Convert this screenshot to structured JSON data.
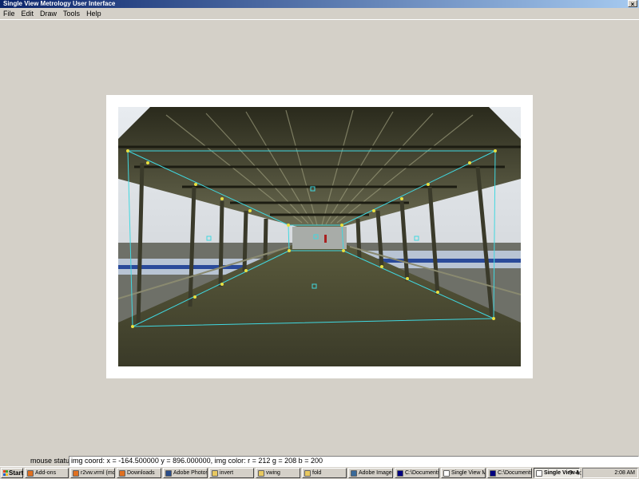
{
  "window": {
    "title": "Single View Metrology User Interface",
    "close_glyph": "×"
  },
  "menu": [
    {
      "label": "File",
      "mnemonic": "F"
    },
    {
      "label": "Edit",
      "mnemonic": "E"
    },
    {
      "label": "Draw",
      "mnemonic": "D"
    },
    {
      "label": "Tools",
      "mnemonic": "T"
    },
    {
      "label": "Help",
      "mnemonic": "H"
    }
  ],
  "status": {
    "label": "mouse status:",
    "text": "img coord: x = -164.500000 y = 896.000000, img color: r = 212 g = 208 b = 200"
  },
  "taskbar": {
    "start_label": "Start",
    "buttons": [
      {
        "label": "Add-ons",
        "icon": "firefox-icon",
        "color": "#e07020"
      },
      {
        "label": "r2vw.vrml (mo...",
        "icon": "firefox-icon",
        "color": "#e07020"
      },
      {
        "label": "Downloads",
        "icon": "firefox-icon",
        "color": "#e07020"
      },
      {
        "label": "Adobe Photoshop",
        "icon": "photoshop-icon",
        "color": "#2a4d8a"
      },
      {
        "label": "invert",
        "icon": "folder-icon",
        "color": "#e8c860"
      },
      {
        "label": "vwing",
        "icon": "folder-icon",
        "color": "#e8c860"
      },
      {
        "label": "fold",
        "icon": "folder-icon",
        "color": "#e8c860"
      },
      {
        "label": "Adobe ImageR...",
        "icon": "imageready-icon",
        "color": "#3a6a9a"
      },
      {
        "label": "C:\\Documents ...",
        "icon": "console-icon",
        "color": "#000080"
      },
      {
        "label": "Single View Me...",
        "icon": "window-icon",
        "color": "#ffffff"
      },
      {
        "label": "C:\\Documents ...",
        "icon": "console-icon",
        "color": "#000080"
      },
      {
        "label": "Single View M...",
        "icon": "window-icon",
        "color": "#ffffff",
        "active": true
      }
    ],
    "tray_extra": [
      "?",
      "≪"
    ],
    "clock": "2:08 AM"
  }
}
